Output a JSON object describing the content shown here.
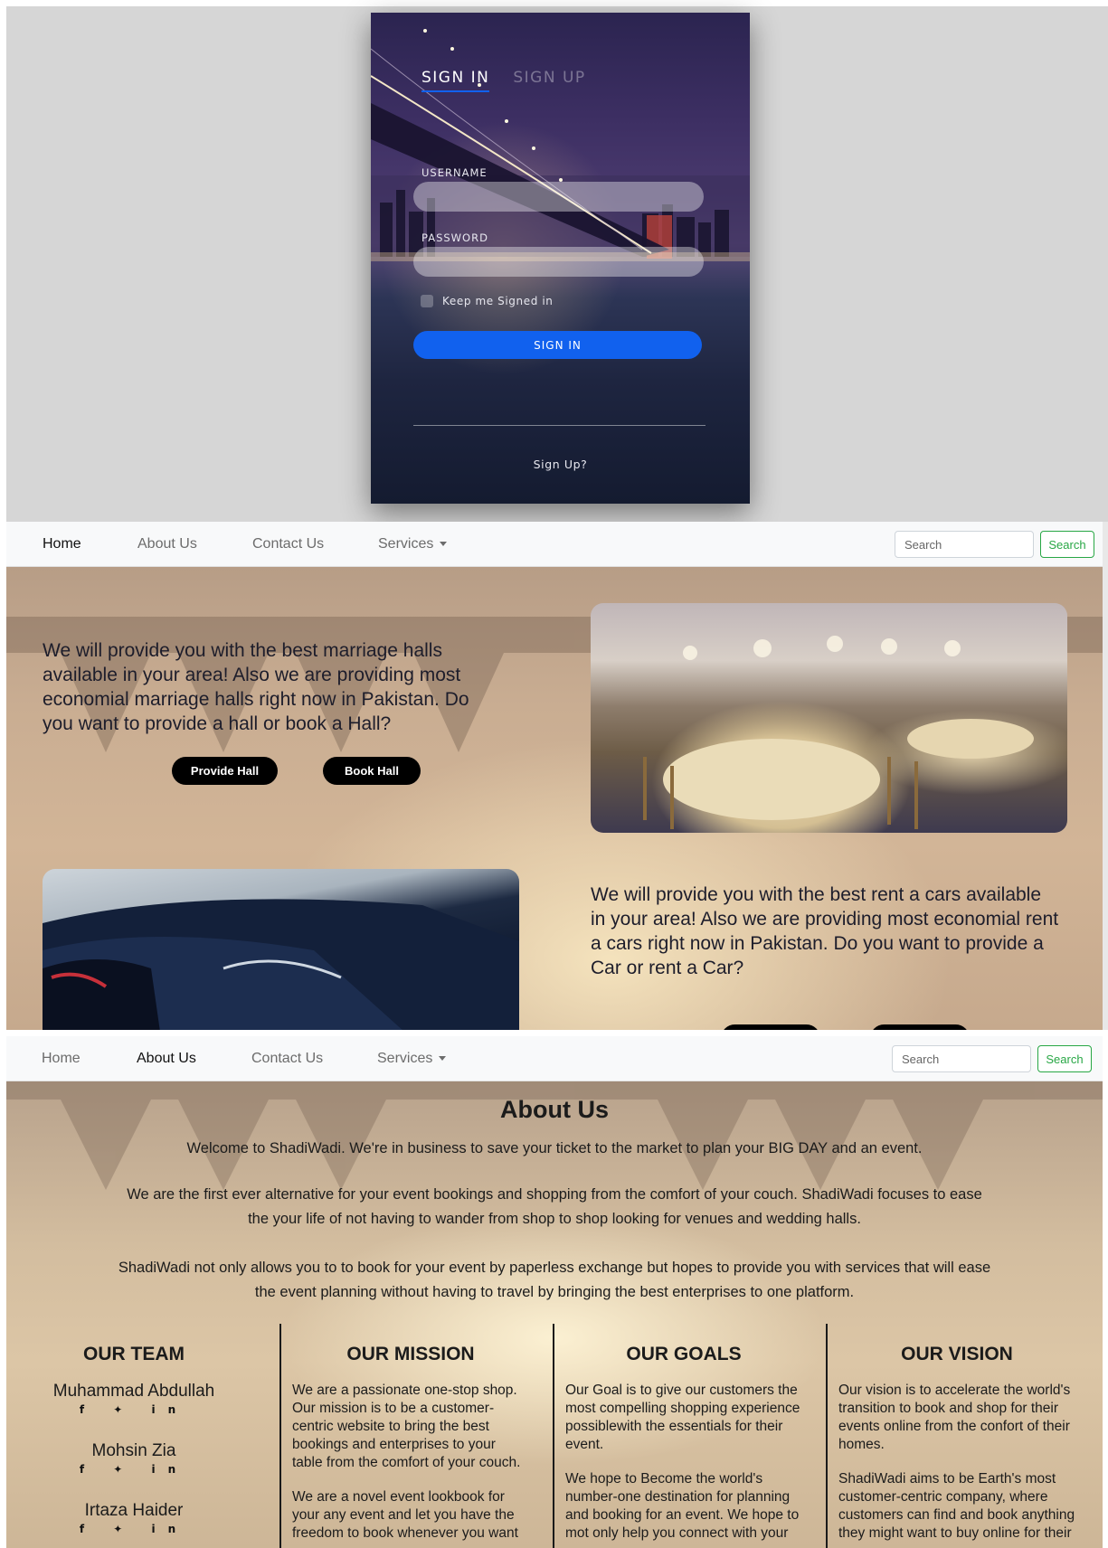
{
  "login": {
    "tab_signin": "SIGN IN",
    "tab_signup": "SIGN UP",
    "username_label": "USERNAME",
    "password_label": "PASSWORD",
    "keep_signed": "Keep me Signed in",
    "signin_button": "SIGN IN",
    "signup_link": "Sign Up?"
  },
  "nav": {
    "home": "Home",
    "about": "About Us",
    "contact": "Contact Us",
    "services": "Services",
    "search_placeholder": "Search",
    "search_button": "Search"
  },
  "home": {
    "hall_text": "We will provide you with the best marriage halls available in your area! Also we are providing most economial marriage halls right now in Pakistan. Do you want to provide a hall or book a Hall?",
    "provide_hall": "Provide Hall",
    "book_hall": "Book Hall",
    "car_text": "We will provide you with the best rent a cars available in your area! Also we are providing most economial rent a cars right now in Pakistan. Do you want to provide a Car or rent a Car?"
  },
  "about": {
    "title": "About Us",
    "para1": "Welcome to ShadiWadi. We're in business to save your ticket to the market to plan your BIG DAY and an event.",
    "para2": "We are the first ever alternative for your event bookings and shopping from the comfort of your couch. ShadiWadi focuses to ease the your life of not having to wander from shop to shop looking for venues and wedding halls.",
    "para3": "ShadiWadi not only allows you to to book for your event by paperless exchange but hopes to provide you with services that will ease the event planning without having to travel by bringing the best enterprises to one platform.",
    "team_head": "OUR TEAM",
    "members": [
      "Muhammad Abdullah",
      "Mohsin Zia",
      "Irtaza Haider"
    ],
    "socials": "f  ✦  in",
    "mission_head": "OUR MISSION",
    "mission_p1": "We are a passionate one-stop shop. Our mission is to be a customer-centric website to bring the best bookings and enterprises to your table from the comfort of your couch.",
    "mission_p2": "We are a novel event lookbook for your any event and let you have the freedom to book whenever you want",
    "goals_head": "OUR GOALS",
    "goals_p1": "Our Goal is to give our customers the most compelling shopping experience possiblewith the essentials for their event.",
    "goals_p2": "We hope to Become the world's number-one destination for planning and booking for an event. We hope to mot only help you connect with your",
    "vision_head": "OUR VISION",
    "vision_p1": "Our vision is to accelerate the world's transition to book and shop for their events online from the confort of their homes.",
    "vision_p2": "ShadiWadi aims to be Earth's most customer-centric company, where customers can find and book anything they might want to buy online for their"
  },
  "colors": {
    "primary_blue": "#1161ee",
    "search_green": "#28a745"
  }
}
